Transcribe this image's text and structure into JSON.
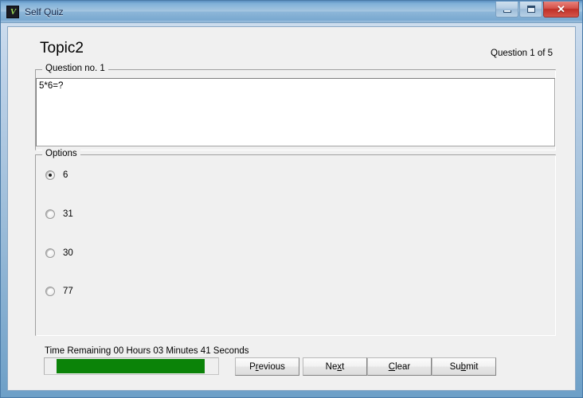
{
  "window": {
    "title": "Self Quiz",
    "app_icon": "vb-app-icon",
    "caption": {
      "minimize": "minimize-icon",
      "maximize": "maximize-icon",
      "close_label": "✕"
    }
  },
  "header": {
    "topic_title": "Topic2",
    "question_counter": "Question 1 of 5"
  },
  "question_group": {
    "legend": "Question no. 1",
    "text": "5*6=?"
  },
  "options_group": {
    "legend": "Options",
    "items": [
      {
        "label": "6",
        "checked": true
      },
      {
        "label": "31",
        "checked": false
      },
      {
        "label": "30",
        "checked": false
      },
      {
        "label": "77",
        "checked": false
      }
    ]
  },
  "footer": {
    "time_remaining": "Time Remaining  00 Hours 03 Minutes 41 Seconds",
    "progress_percent": 93,
    "progress_color": "#0b8308",
    "buttons": {
      "previous": {
        "pre": "P",
        "acc": "r",
        "post": "evious"
      },
      "next": {
        "pre": "Ne",
        "acc": "x",
        "post": "t"
      },
      "clear": {
        "pre": "",
        "acc": "C",
        "post": "lear"
      },
      "submit": {
        "pre": "Su",
        "acc": "b",
        "post": "mit"
      }
    }
  }
}
